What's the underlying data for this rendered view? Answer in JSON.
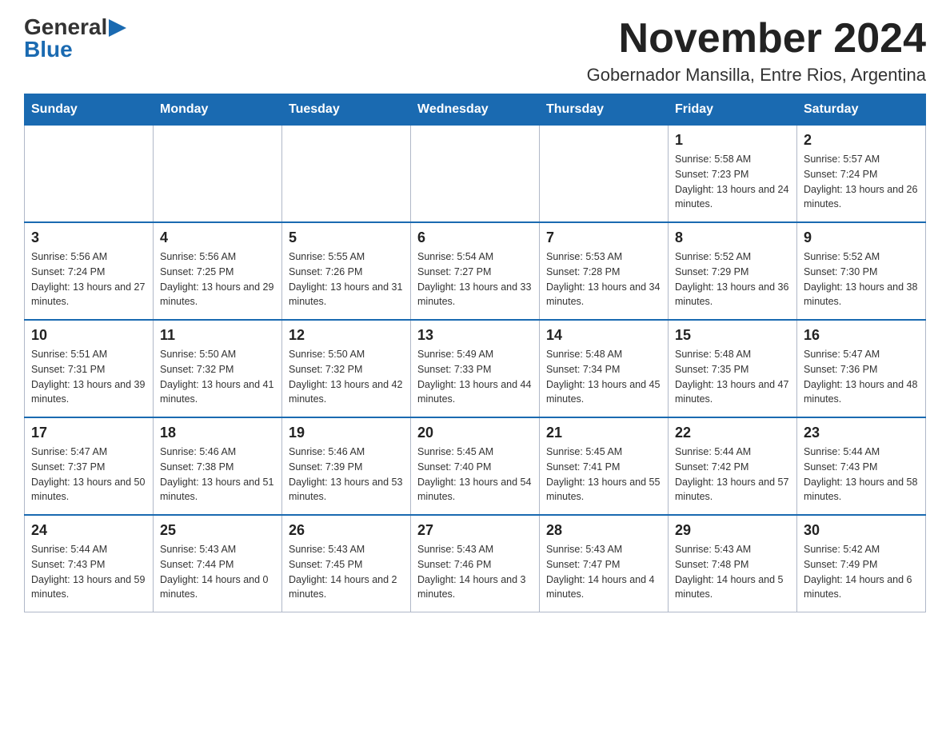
{
  "header": {
    "logo_general": "General",
    "logo_blue": "Blue",
    "month_title": "November 2024",
    "location": "Gobernador Mansilla, Entre Rios, Argentina"
  },
  "weekdays": [
    "Sunday",
    "Monday",
    "Tuesday",
    "Wednesday",
    "Thursday",
    "Friday",
    "Saturday"
  ],
  "weeks": [
    [
      {
        "day": "",
        "sunrise": "",
        "sunset": "",
        "daylight": ""
      },
      {
        "day": "",
        "sunrise": "",
        "sunset": "",
        "daylight": ""
      },
      {
        "day": "",
        "sunrise": "",
        "sunset": "",
        "daylight": ""
      },
      {
        "day": "",
        "sunrise": "",
        "sunset": "",
        "daylight": ""
      },
      {
        "day": "",
        "sunrise": "",
        "sunset": "",
        "daylight": ""
      },
      {
        "day": "1",
        "sunrise": "Sunrise: 5:58 AM",
        "sunset": "Sunset: 7:23 PM",
        "daylight": "Daylight: 13 hours and 24 minutes."
      },
      {
        "day": "2",
        "sunrise": "Sunrise: 5:57 AM",
        "sunset": "Sunset: 7:24 PM",
        "daylight": "Daylight: 13 hours and 26 minutes."
      }
    ],
    [
      {
        "day": "3",
        "sunrise": "Sunrise: 5:56 AM",
        "sunset": "Sunset: 7:24 PM",
        "daylight": "Daylight: 13 hours and 27 minutes."
      },
      {
        "day": "4",
        "sunrise": "Sunrise: 5:56 AM",
        "sunset": "Sunset: 7:25 PM",
        "daylight": "Daylight: 13 hours and 29 minutes."
      },
      {
        "day": "5",
        "sunrise": "Sunrise: 5:55 AM",
        "sunset": "Sunset: 7:26 PM",
        "daylight": "Daylight: 13 hours and 31 minutes."
      },
      {
        "day": "6",
        "sunrise": "Sunrise: 5:54 AM",
        "sunset": "Sunset: 7:27 PM",
        "daylight": "Daylight: 13 hours and 33 minutes."
      },
      {
        "day": "7",
        "sunrise": "Sunrise: 5:53 AM",
        "sunset": "Sunset: 7:28 PM",
        "daylight": "Daylight: 13 hours and 34 minutes."
      },
      {
        "day": "8",
        "sunrise": "Sunrise: 5:52 AM",
        "sunset": "Sunset: 7:29 PM",
        "daylight": "Daylight: 13 hours and 36 minutes."
      },
      {
        "day": "9",
        "sunrise": "Sunrise: 5:52 AM",
        "sunset": "Sunset: 7:30 PM",
        "daylight": "Daylight: 13 hours and 38 minutes."
      }
    ],
    [
      {
        "day": "10",
        "sunrise": "Sunrise: 5:51 AM",
        "sunset": "Sunset: 7:31 PM",
        "daylight": "Daylight: 13 hours and 39 minutes."
      },
      {
        "day": "11",
        "sunrise": "Sunrise: 5:50 AM",
        "sunset": "Sunset: 7:32 PM",
        "daylight": "Daylight: 13 hours and 41 minutes."
      },
      {
        "day": "12",
        "sunrise": "Sunrise: 5:50 AM",
        "sunset": "Sunset: 7:32 PM",
        "daylight": "Daylight: 13 hours and 42 minutes."
      },
      {
        "day": "13",
        "sunrise": "Sunrise: 5:49 AM",
        "sunset": "Sunset: 7:33 PM",
        "daylight": "Daylight: 13 hours and 44 minutes."
      },
      {
        "day": "14",
        "sunrise": "Sunrise: 5:48 AM",
        "sunset": "Sunset: 7:34 PM",
        "daylight": "Daylight: 13 hours and 45 minutes."
      },
      {
        "day": "15",
        "sunrise": "Sunrise: 5:48 AM",
        "sunset": "Sunset: 7:35 PM",
        "daylight": "Daylight: 13 hours and 47 minutes."
      },
      {
        "day": "16",
        "sunrise": "Sunrise: 5:47 AM",
        "sunset": "Sunset: 7:36 PM",
        "daylight": "Daylight: 13 hours and 48 minutes."
      }
    ],
    [
      {
        "day": "17",
        "sunrise": "Sunrise: 5:47 AM",
        "sunset": "Sunset: 7:37 PM",
        "daylight": "Daylight: 13 hours and 50 minutes."
      },
      {
        "day": "18",
        "sunrise": "Sunrise: 5:46 AM",
        "sunset": "Sunset: 7:38 PM",
        "daylight": "Daylight: 13 hours and 51 minutes."
      },
      {
        "day": "19",
        "sunrise": "Sunrise: 5:46 AM",
        "sunset": "Sunset: 7:39 PM",
        "daylight": "Daylight: 13 hours and 53 minutes."
      },
      {
        "day": "20",
        "sunrise": "Sunrise: 5:45 AM",
        "sunset": "Sunset: 7:40 PM",
        "daylight": "Daylight: 13 hours and 54 minutes."
      },
      {
        "day": "21",
        "sunrise": "Sunrise: 5:45 AM",
        "sunset": "Sunset: 7:41 PM",
        "daylight": "Daylight: 13 hours and 55 minutes."
      },
      {
        "day": "22",
        "sunrise": "Sunrise: 5:44 AM",
        "sunset": "Sunset: 7:42 PM",
        "daylight": "Daylight: 13 hours and 57 minutes."
      },
      {
        "day": "23",
        "sunrise": "Sunrise: 5:44 AM",
        "sunset": "Sunset: 7:43 PM",
        "daylight": "Daylight: 13 hours and 58 minutes."
      }
    ],
    [
      {
        "day": "24",
        "sunrise": "Sunrise: 5:44 AM",
        "sunset": "Sunset: 7:43 PM",
        "daylight": "Daylight: 13 hours and 59 minutes."
      },
      {
        "day": "25",
        "sunrise": "Sunrise: 5:43 AM",
        "sunset": "Sunset: 7:44 PM",
        "daylight": "Daylight: 14 hours and 0 minutes."
      },
      {
        "day": "26",
        "sunrise": "Sunrise: 5:43 AM",
        "sunset": "Sunset: 7:45 PM",
        "daylight": "Daylight: 14 hours and 2 minutes."
      },
      {
        "day": "27",
        "sunrise": "Sunrise: 5:43 AM",
        "sunset": "Sunset: 7:46 PM",
        "daylight": "Daylight: 14 hours and 3 minutes."
      },
      {
        "day": "28",
        "sunrise": "Sunrise: 5:43 AM",
        "sunset": "Sunset: 7:47 PM",
        "daylight": "Daylight: 14 hours and 4 minutes."
      },
      {
        "day": "29",
        "sunrise": "Sunrise: 5:43 AM",
        "sunset": "Sunset: 7:48 PM",
        "daylight": "Daylight: 14 hours and 5 minutes."
      },
      {
        "day": "30",
        "sunrise": "Sunrise: 5:42 AM",
        "sunset": "Sunset: 7:49 PM",
        "daylight": "Daylight: 14 hours and 6 minutes."
      }
    ]
  ]
}
